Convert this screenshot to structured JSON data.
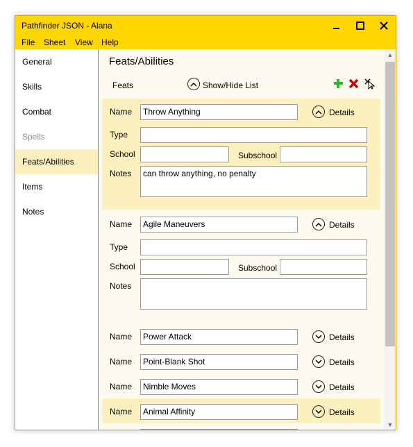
{
  "window": {
    "title": "Pathfinder JSON - Alana"
  },
  "menu": [
    "File",
    "Sheet",
    "View",
    "Help"
  ],
  "sidebar": {
    "items": [
      {
        "label": "General"
      },
      {
        "label": "Skills"
      },
      {
        "label": "Combat"
      },
      {
        "label": "Spells"
      },
      {
        "label": "Feats/Abilities"
      },
      {
        "label": "Items"
      },
      {
        "label": "Notes"
      }
    ],
    "active": "Feats/Abilities",
    "disabled": [
      "Spells"
    ]
  },
  "page": {
    "title": "Feats/Abilities",
    "section_label": "Feats",
    "toggle_label": "Show/Hide List"
  },
  "labels": {
    "name": "Name",
    "type": "Type",
    "school": "School",
    "subschool": "Subschool",
    "notes": "Notes",
    "details": "Details"
  },
  "feats": [
    {
      "name": "Throw Anything",
      "type": "",
      "school": "",
      "subschool": "",
      "notes": "can throw anything, no penalty",
      "expanded": true
    },
    {
      "name": "Agile Maneuvers",
      "type": "",
      "school": "",
      "subschool": "",
      "notes": "",
      "expanded": true
    },
    {
      "name": "Power Attack",
      "expanded": false
    },
    {
      "name": "Point-Blank Shot",
      "expanded": false
    },
    {
      "name": "Nimble Moves",
      "expanded": false
    },
    {
      "name": "Animal Affinity",
      "expanded": false
    }
  ],
  "colors": {
    "titlebar": "#ffd700",
    "highlight": "#fdf0bf",
    "content_bg": "#fdfbf0",
    "add": "#2db82d",
    "delete": "#d40000"
  },
  "icons": {
    "minimize": "minimize-icon",
    "maximize": "maximize-icon",
    "close": "close-icon",
    "add": "add-icon",
    "delete": "delete-icon",
    "clear": "clear-icon",
    "chevron_up": "chevron-up-icon",
    "chevron_down": "chevron-down-icon"
  }
}
